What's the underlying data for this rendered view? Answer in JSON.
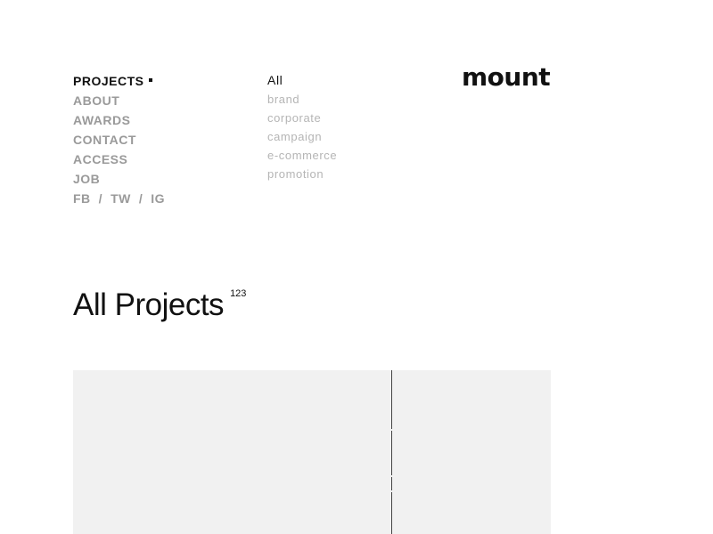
{
  "nav": {
    "items": [
      {
        "label": "PROJECTS",
        "active": true
      },
      {
        "label": "ABOUT",
        "active": false
      },
      {
        "label": "AWARDS",
        "active": false
      },
      {
        "label": "CONTACT",
        "active": false
      },
      {
        "label": "ACCESS",
        "active": false
      },
      {
        "label": "JOB",
        "active": false
      }
    ],
    "social": {
      "fb": "FB",
      "tw": "TW",
      "ig": "IG",
      "separator": "/"
    }
  },
  "categories": {
    "items": [
      {
        "label": "All",
        "active": true
      },
      {
        "label": "brand",
        "active": false
      },
      {
        "label": "corporate",
        "active": false
      },
      {
        "label": "campaign",
        "active": false
      },
      {
        "label": "e-commerce",
        "active": false
      },
      {
        "label": "promotion",
        "active": false
      }
    ]
  },
  "logo": {
    "text": "mount"
  },
  "header": {
    "title": "All Projects",
    "count": "123"
  },
  "colors": {
    "text": "#111111",
    "muted": "#9a9a9a",
    "category_muted": "#b5b5b5",
    "card_background": "#f1f1f1",
    "divider": "#444444"
  }
}
